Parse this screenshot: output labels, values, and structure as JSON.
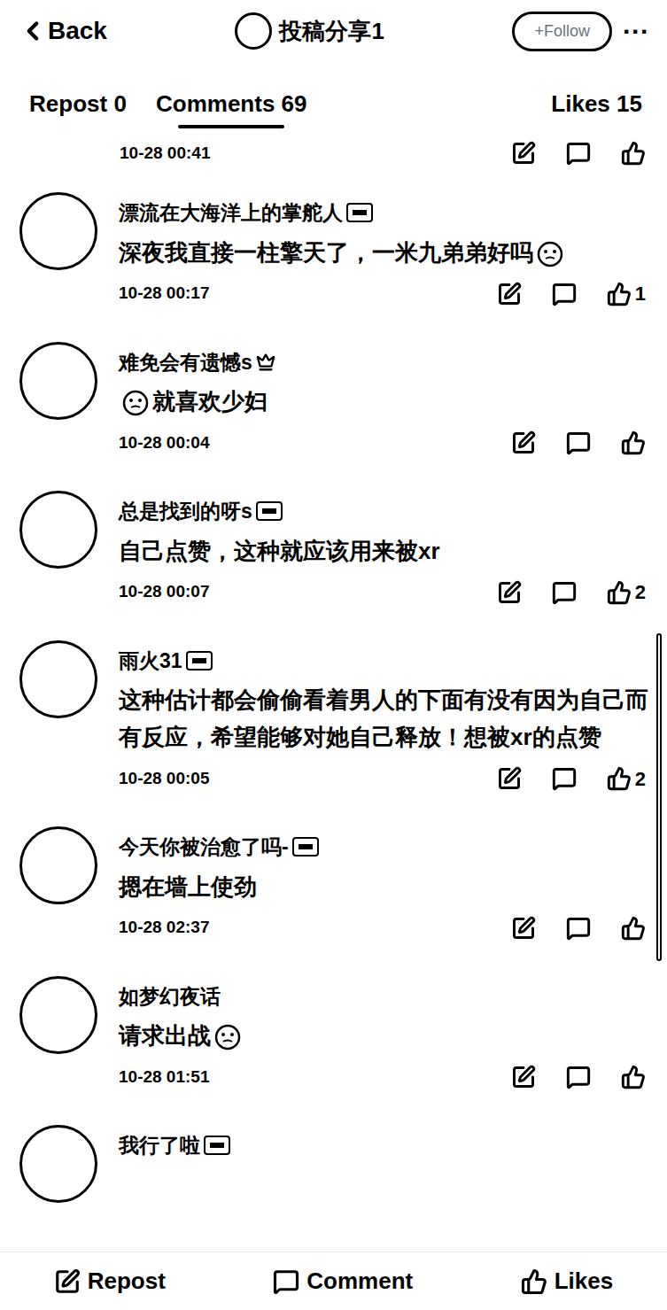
{
  "header": {
    "back": "Back",
    "title": "投稿分享1",
    "follow": "+Follow",
    "more": "···"
  },
  "stats": [
    {
      "label": "Repost",
      "count": "0",
      "selected": false
    },
    {
      "label": "Comments",
      "count": "69",
      "selected": true
    },
    {
      "label": "Likes",
      "count": "15",
      "selected": false
    }
  ],
  "comments": [
    {
      "kind": "time-only",
      "name": "",
      "badge": "none",
      "text": "",
      "emoji": "none",
      "time": "10-28 00:41",
      "likes": ""
    },
    {
      "kind": "full",
      "name": "漂流在大海洋上的掌舵人",
      "badge": "level",
      "text": "深夜我直接一柱擎天了，一米九弟弟好吗",
      "emoji": "after",
      "time": "10-28 00:17",
      "likes": "1"
    },
    {
      "kind": "full",
      "name": "难免会有遗憾s",
      "badge": "crown",
      "text": "就喜欢少妇",
      "emoji": "before",
      "time": "10-28 00:04",
      "likes": ""
    },
    {
      "kind": "full",
      "name": "总是找到的呀s",
      "badge": "level",
      "text": "自己点赞，这种就应该用来被xr",
      "emoji": "none",
      "time": "10-28 00:07",
      "likes": "2"
    },
    {
      "kind": "full",
      "name": "雨火31",
      "badge": "level",
      "text": "这种估计都会偷偷看着男人的下面有没有因为自己而有反应，希望能够对她自己释放！想被xr的点赞",
      "emoji": "none",
      "time": "10-28 00:05",
      "likes": "2"
    },
    {
      "kind": "full",
      "name": "今天你被治愈了吗-",
      "badge": "level",
      "text": "摁在墙上使劲",
      "emoji": "none",
      "time": "10-28 02:37",
      "likes": ""
    },
    {
      "kind": "full",
      "name": "如梦幻夜话",
      "badge": "none",
      "text": "请求出战",
      "emoji": "after",
      "time": "10-28 01:51",
      "likes": ""
    },
    {
      "kind": "name-only",
      "name": "我行了啦",
      "badge": "level",
      "text": "",
      "emoji": "none",
      "time": "",
      "likes": ""
    }
  ],
  "bottom_bar": [
    {
      "label": "Repost"
    },
    {
      "label": "Comment"
    },
    {
      "label": "Likes"
    }
  ]
}
